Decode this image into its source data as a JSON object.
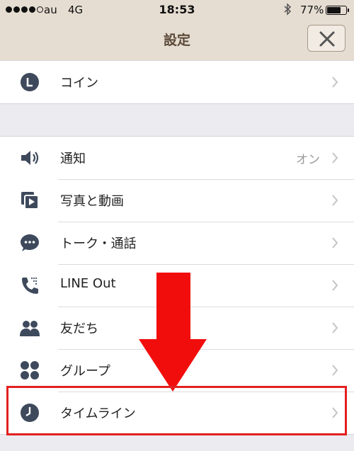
{
  "status_bar": {
    "carrier": "au",
    "network": "4G",
    "time": "18:53",
    "battery_percent": "77%",
    "battery_level": 0.77,
    "signal_bars": 4,
    "signal_total": 5,
    "icons": [
      "signal-dots-icon",
      "bluetooth-icon",
      "battery-icon"
    ]
  },
  "nav": {
    "title": "設定",
    "close_icon": "close-icon"
  },
  "section1": [
    {
      "label": "コイン",
      "icon": "coin-icon"
    }
  ],
  "section2": [
    {
      "label": "通知",
      "value": "オン",
      "icon": "speaker-icon"
    },
    {
      "label": "写真と動画",
      "icon": "photo-video-icon"
    },
    {
      "label": "トーク・通話",
      "icon": "chat-bubble-icon"
    },
    {
      "label": "LINE Out",
      "icon": "phone-icon"
    },
    {
      "label": "友だち",
      "icon": "friends-icon"
    },
    {
      "label": "グループ",
      "icon": "group-icon"
    },
    {
      "label": "タイムライン",
      "icon": "clock-icon"
    }
  ],
  "annotation": {
    "arrow_color": "#f20d0d",
    "highlight_color": "#e32020"
  },
  "colors": {
    "nav_bg": "#e6ddd2",
    "icon": "#3e4a5c",
    "page_bg": "#ecebf0"
  }
}
